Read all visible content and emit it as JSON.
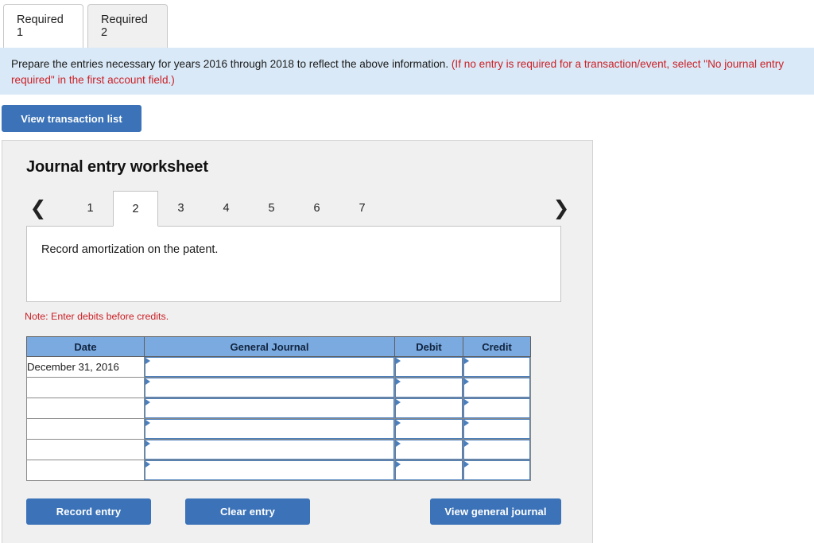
{
  "requirement_tabs": [
    {
      "label": "Required 1",
      "active": true
    },
    {
      "label": "Required 2",
      "active": false
    }
  ],
  "banner": {
    "black_text": "Prepare the entries necessary for years 2016 through 2018 to reflect the above information.",
    "red_text": "(If no entry is required for a transaction/event, select \"No journal entry required\" in the first account field.)"
  },
  "toolbar": {
    "view_transaction_list_label": "View transaction list"
  },
  "worksheet": {
    "title": "Journal entry worksheet",
    "prev_icon": "chevron-left-icon",
    "next_icon": "chevron-right-icon",
    "entry_tabs": [
      {
        "label": "1",
        "active": false
      },
      {
        "label": "2",
        "active": true
      },
      {
        "label": "3",
        "active": false
      },
      {
        "label": "4",
        "active": false
      },
      {
        "label": "5",
        "active": false
      },
      {
        "label": "6",
        "active": false
      },
      {
        "label": "7",
        "active": false
      }
    ],
    "description": "Record amortization on the patent.",
    "note": "Note: Enter debits before credits.",
    "table": {
      "headers": [
        "Date",
        "General Journal",
        "Debit",
        "Credit"
      ],
      "rows": [
        {
          "date": "December 31, 2016",
          "general_journal": "",
          "debit": "",
          "credit": ""
        },
        {
          "date": "",
          "general_journal": "",
          "debit": "",
          "credit": ""
        },
        {
          "date": "",
          "general_journal": "",
          "debit": "",
          "credit": ""
        },
        {
          "date": "",
          "general_journal": "",
          "debit": "",
          "credit": ""
        },
        {
          "date": "",
          "general_journal": "",
          "debit": "",
          "credit": ""
        },
        {
          "date": "",
          "general_journal": "",
          "debit": "",
          "credit": ""
        }
      ]
    },
    "buttons": {
      "record_entry": "Record entry",
      "clear_entry": "Clear entry",
      "view_general_journal": "View general journal"
    }
  },
  "colors": {
    "button_blue": "#3b72b8",
    "table_header_blue": "#7baae0",
    "banner_blue": "#d9e9f7",
    "note_red": "#cc2026",
    "panel_gray": "#f0f0f0",
    "input_border_blue": "#4a7fbd"
  }
}
